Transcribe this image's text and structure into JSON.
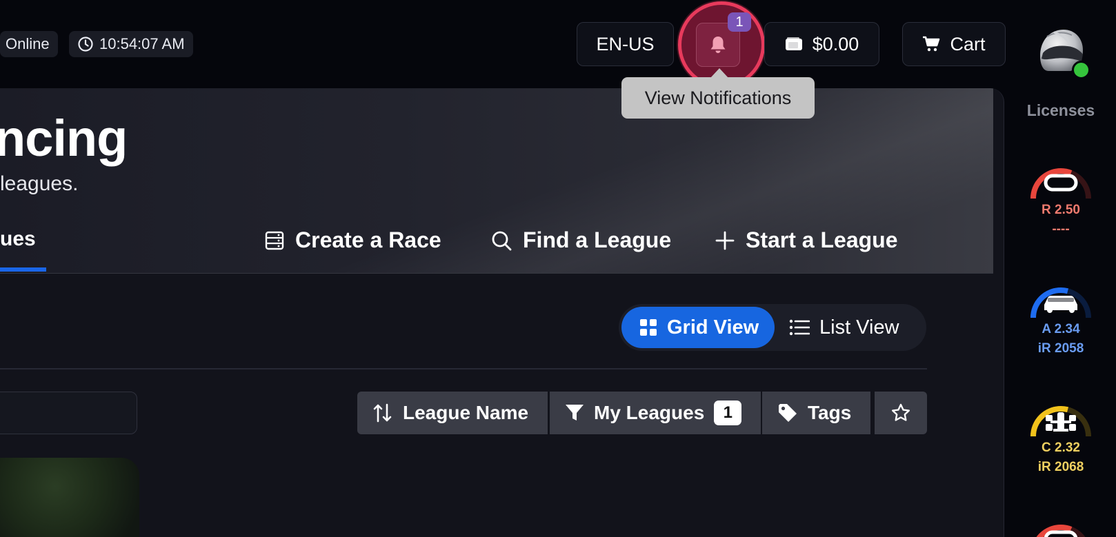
{
  "topbar": {
    "status_label": "Online",
    "clock_time": "10:54:07 AM",
    "language_label": "EN-US",
    "notification_count": "1",
    "notification_tooltip": "View Notifications",
    "wallet_label": "$0.00",
    "cart_label": "Cart"
  },
  "hero": {
    "title": "ncing",
    "subtitle": "leagues.",
    "active_tab": "ues",
    "links": {
      "create_race": "Create a Race",
      "find_league": "Find a League",
      "start_league": "Start a League"
    }
  },
  "view_toggle": {
    "grid_label": "Grid View",
    "list_label": "List View",
    "selected": "grid"
  },
  "filters": {
    "sort_label": "League Name",
    "my_leagues_label": "My Leagues",
    "my_leagues_count": "1",
    "tags_label": "Tags"
  },
  "licenses": {
    "title": "Licenses",
    "items": [
      {
        "category": "oval",
        "line1": "R 2.50",
        "line2": "----",
        "color": "#e8463c",
        "label_color": "#f07a6e",
        "fill": 0.62
      },
      {
        "category": "sports-car",
        "line1": "A 2.34",
        "line2": "iR 2058",
        "color": "#1e6cf0",
        "label_color": "#6a9cf2",
        "fill": 0.58
      },
      {
        "category": "formula-car",
        "line1": "C 2.32",
        "line2": "iR 2068",
        "color": "#f2c21b",
        "label_color": "#f0d060",
        "fill": 0.58
      },
      {
        "category": "oval",
        "line1": "",
        "line2": "",
        "color": "#e8463c",
        "label_color": "#f07a6e",
        "fill": 0.62
      }
    ]
  },
  "colors": {
    "accent_blue": "#1766e0",
    "notification_ring": "#e83a5c",
    "online_dot": "#35c43c"
  }
}
